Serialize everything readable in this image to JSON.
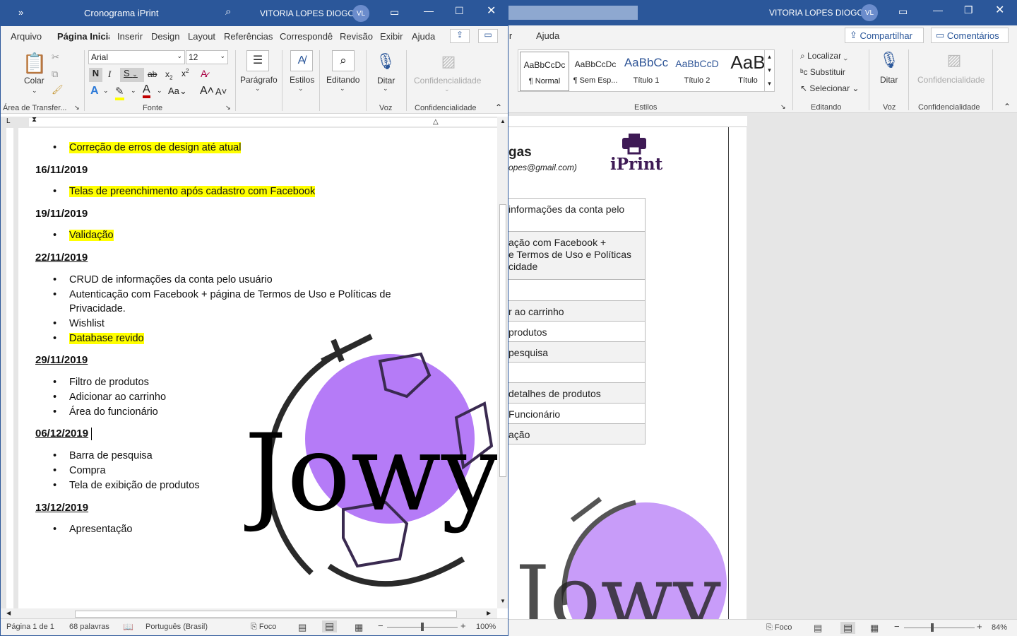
{
  "back_window": {
    "user": "VITORIA LOPES DIOGO",
    "avatar": "VL",
    "tab_partial": "ir",
    "tab_ajuda": "Ajuda",
    "share": "Compartilhar",
    "comments": "Comentários",
    "styles": [
      {
        "preview": "AaBbCcDc",
        "name": "¶ Normal"
      },
      {
        "preview": "AaBbCcDc",
        "name": "¶ Sem Esp..."
      },
      {
        "preview": "AaBbCc",
        "name": "Título 1"
      },
      {
        "preview": "AaBbCcD",
        "name": "Título 2"
      },
      {
        "preview": "AaB",
        "name": "Título"
      }
    ],
    "group_estilos": "Estilos",
    "find": "Localizar",
    "replace": "Substituir",
    "select": "Selecionar",
    "group_editando": "Editando",
    "dictate": "Ditar",
    "group_voz": "Voz",
    "confidentiality": "Confidencialidade",
    "group_conf": "Confidencialidade",
    "doc_heading_partial": "gas",
    "doc_email_partial": "opes@gmail.com)",
    "logo_text": "iPrint",
    "table_rows": [
      "informações da conta pelo",
      "ação com Facebook +\ne Termos de Uso e Políticas\ncidade",
      "",
      "r ao carrinho",
      "produtos",
      "pesquisa",
      "",
      "detalhes de produtos",
      "Funcionário",
      "ação"
    ],
    "status_focus": "Foco",
    "zoom": "84%",
    "watermark": "Jowy"
  },
  "front_window": {
    "title": "Cronograma iPrint",
    "user": "VITORIA LOPES DIOGO",
    "avatar": "VL",
    "tabs": [
      "Arquivo",
      "Página Inicial",
      "Inserir",
      "Design",
      "Layout",
      "Referências",
      "Correspondê",
      "Revisão",
      "Exibir",
      "Ajuda"
    ],
    "font_name": "Arial",
    "font_size": "12",
    "paste_label": "Colar",
    "clipboard_group": "Área de Transfer...",
    "font_group": "Fonte",
    "paragraph": "Parágrafo",
    "styles": "Estilos",
    "editing": "Editando",
    "dictate": "Ditar",
    "voice_group": "Voz",
    "confidentiality": "Confidencialidade",
    "conf_group": "Confidencialidade",
    "doc": {
      "bullet0": "Correção de erros de design até atual",
      "sections": [
        {
          "date": "16/11/2019",
          "items": [
            "Telas de preenchimento após cadastro com Facebook"
          ]
        },
        {
          "date": "19/11/2019",
          "items": [
            "Validação"
          ]
        },
        {
          "date": "22/11/2019",
          "items": [
            "CRUD de informações da conta pelo usuário",
            "Autenticação com Facebook + página de Termos de Uso e Políticas de",
            "Privacidade.",
            "Wishlist",
            "Database revido"
          ]
        },
        {
          "date": "29/11/2019",
          "items": [
            "Filtro de produtos",
            "Adicionar ao carrinho",
            "Área do funcionário"
          ]
        },
        {
          "date": "06/12/2019",
          "items": [
            "Barra de pesquisa",
            "Compra",
            "Tela de exibição de produtos"
          ]
        },
        {
          "date": "13/12/2019",
          "items": [
            "Apresentação"
          ]
        }
      ],
      "watermark": "Jowy"
    },
    "status": {
      "page": "Página 1 de 1",
      "words": "68 palavras",
      "lang": "Português (Brasil)",
      "focus": "Foco",
      "zoom": "100%"
    }
  },
  "colors": {
    "accent": "#2b579a",
    "highlight": "#ffff00",
    "globe": "#b57bf7"
  }
}
